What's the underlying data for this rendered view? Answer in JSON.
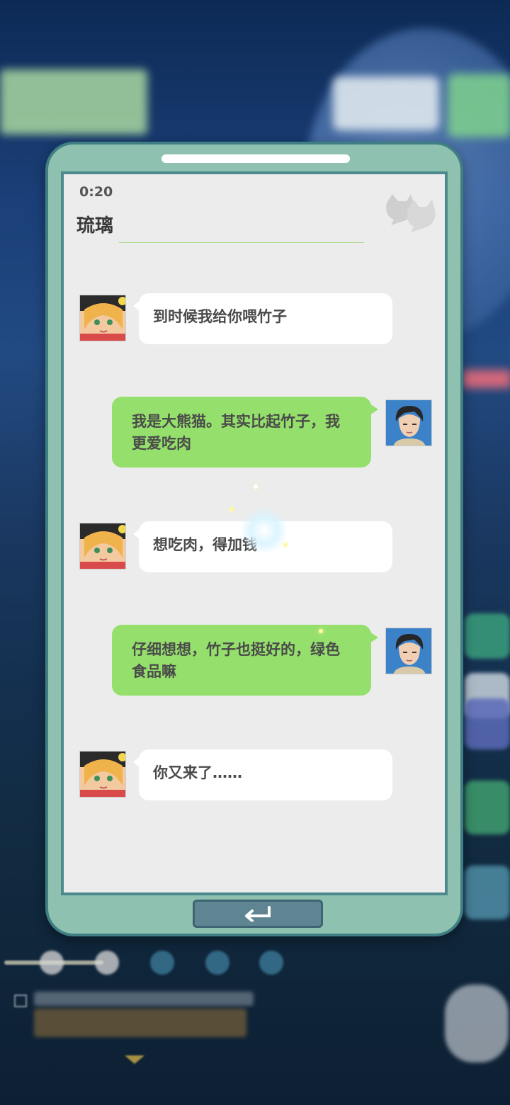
{
  "chat": {
    "time": "0:20",
    "contact_name": "琉璃",
    "messages": [
      {
        "sender": "琉璃",
        "side": "left",
        "text": "到时候我给你喂竹子"
      },
      {
        "sender": "player",
        "side": "right",
        "text": "我是大熊猫。其实比起竹子，我更爱吃肉"
      },
      {
        "sender": "琉璃",
        "side": "left",
        "text": "想吃肉，得加钱"
      },
      {
        "sender": "player",
        "side": "right",
        "text": "仔细想想，竹子也挺好的，绿色食品嘛"
      },
      {
        "sender": "琉璃",
        "side": "left",
        "text": "你又来了……"
      }
    ]
  },
  "icons": {
    "header": "cat-icon",
    "return": "return-arrow-icon"
  },
  "colors": {
    "phone_frame": "#8ec1af",
    "phone_border": "#3f7e82",
    "screen_bg": "#ececec",
    "bubble_left": "#ffffff",
    "bubble_right": "#95e06c",
    "return_button": "#5f8593"
  }
}
